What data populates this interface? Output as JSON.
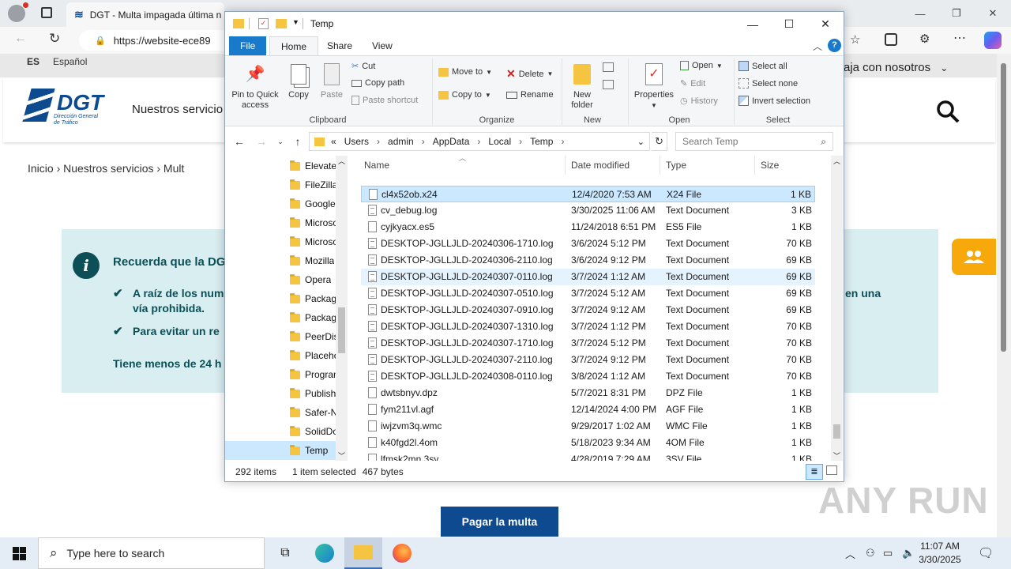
{
  "browser": {
    "tab_title": "DGT - Multa impagada última n",
    "url": "https://website-ece89"
  },
  "page": {
    "lang_code": "ES",
    "lang_label": "Español",
    "right_nav": "aja con nosotros",
    "nav_services": "Nuestros servicio",
    "breadcrumb": "Inicio  ›  Nuestros servicios  ›  Mult",
    "notice_title": "Recuerda que la DGT",
    "notice_item1_line1": "A raíz de los num",
    "notice_item1_line1_right": "en una",
    "notice_item1_line2": "vía prohibida.",
    "notice_item2": "Para evitar un re",
    "notice_footer": "Tiene menos de 24 h",
    "pay_button": "Pagar la multa",
    "watermark": "ANY RUN",
    "logo_text": "DGT",
    "logo_sub1": "Dirección General",
    "logo_sub2": "de Tráfico"
  },
  "explorer": {
    "title": "Temp",
    "tabs": [
      "File",
      "Home",
      "Share",
      "View"
    ],
    "ribbon": {
      "clipboard": {
        "label": "Clipboard",
        "pin": "Pin to Quick\naccess",
        "copy": "Copy",
        "paste": "Paste",
        "cut": "Cut",
        "copy_path": "Copy path",
        "paste_shortcut": "Paste shortcut"
      },
      "organize": {
        "label": "Organize",
        "move_to": "Move to",
        "copy_to": "Copy to",
        "delete": "Delete",
        "rename": "Rename"
      },
      "new": {
        "label": "New",
        "new_folder": "New\nfolder"
      },
      "open": {
        "label": "Open",
        "properties": "Properties",
        "open": "Open",
        "edit": "Edit",
        "history": "History"
      },
      "select": {
        "label": "Select",
        "select_all": "Select all",
        "select_none": "Select none",
        "invert": "Invert selection"
      }
    },
    "address": {
      "prefix": "«",
      "crumbs": [
        "Users",
        "admin",
        "AppData",
        "Local",
        "Temp"
      ],
      "search_placeholder": "Search Temp"
    },
    "nav_pane": [
      "Elevate",
      "FileZilla",
      "Google",
      "Microso",
      "Microso",
      "Mozilla",
      "Opera",
      "Packag",
      "Packag",
      "PeerDis",
      "Placeho",
      "Program",
      "Publish",
      "Safer-N",
      "SolidDo",
      "Temp"
    ],
    "columns": {
      "name": "Name",
      "date": "Date modified",
      "type": "Type",
      "size": "Size"
    },
    "files": [
      {
        "name": "cl4x52ob.x24",
        "date": "12/4/2020 7:53 AM",
        "type": "X24 File",
        "size": "1 KB"
      },
      {
        "name": "cv_debug.log",
        "date": "3/30/2025 11:06 AM",
        "type": "Text Document",
        "size": "3 KB"
      },
      {
        "name": "cyjkyacx.es5",
        "date": "11/24/2018 6:51 PM",
        "type": "ES5 File",
        "size": "1 KB"
      },
      {
        "name": "DESKTOP-JGLLJLD-20240306-1710.log",
        "date": "3/6/2024 5:12 PM",
        "type": "Text Document",
        "size": "70 KB"
      },
      {
        "name": "DESKTOP-JGLLJLD-20240306-2110.log",
        "date": "3/6/2024 9:12 PM",
        "type": "Text Document",
        "size": "69 KB"
      },
      {
        "name": "DESKTOP-JGLLJLD-20240307-0110.log",
        "date": "3/7/2024 1:12 AM",
        "type": "Text Document",
        "size": "69 KB"
      },
      {
        "name": "DESKTOP-JGLLJLD-20240307-0510.log",
        "date": "3/7/2024 5:12 AM",
        "type": "Text Document",
        "size": "69 KB"
      },
      {
        "name": "DESKTOP-JGLLJLD-20240307-0910.log",
        "date": "3/7/2024 9:12 AM",
        "type": "Text Document",
        "size": "69 KB"
      },
      {
        "name": "DESKTOP-JGLLJLD-20240307-1310.log",
        "date": "3/7/2024 1:12 PM",
        "type": "Text Document",
        "size": "70 KB"
      },
      {
        "name": "DESKTOP-JGLLJLD-20240307-1710.log",
        "date": "3/7/2024 5:12 PM",
        "type": "Text Document",
        "size": "70 KB"
      },
      {
        "name": "DESKTOP-JGLLJLD-20240307-2110.log",
        "date": "3/7/2024 9:12 PM",
        "type": "Text Document",
        "size": "70 KB"
      },
      {
        "name": "DESKTOP-JGLLJLD-20240308-0110.log",
        "date": "3/8/2024 1:12 AM",
        "type": "Text Document",
        "size": "70 KB"
      },
      {
        "name": "dwtsbnyv.dpz",
        "date": "5/7/2021 8:31 PM",
        "type": "DPZ File",
        "size": "1 KB"
      },
      {
        "name": "fym211vl.agf",
        "date": "12/14/2024 4:00 PM",
        "type": "AGF File",
        "size": "1 KB"
      },
      {
        "name": "iwjzvm3q.wmc",
        "date": "9/29/2017 1:02 AM",
        "type": "WMC File",
        "size": "1 KB"
      },
      {
        "name": "k40fgd2l.4om",
        "date": "5/18/2023 9:34 AM",
        "type": "4OM File",
        "size": "1 KB"
      },
      {
        "name": "lfmsk2mn.3sv",
        "date": "4/28/2019 7:29 AM",
        "type": "3SV File",
        "size": "1 KB"
      }
    ],
    "status": {
      "count": "292 items",
      "selected": "1 item selected",
      "bytes": "467 bytes"
    }
  },
  "taskbar": {
    "search_placeholder": "Type here to search",
    "time": "11:07 AM",
    "date": "3/30/2025"
  }
}
